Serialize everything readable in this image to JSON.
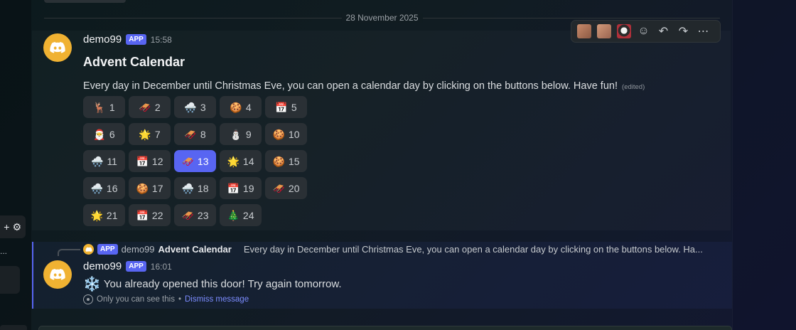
{
  "divider": {
    "date": "28 November 2025"
  },
  "message1": {
    "author": "demo99",
    "badge": "APP",
    "time": "15:58",
    "title": "Advent Calendar",
    "text": "Every day in December until Christmas Eve, you can open a calendar day by clicking on the buttons below. Have fun!",
    "edited": "(edited)",
    "buttons": [
      {
        "day": "1",
        "emoji": "🦌"
      },
      {
        "day": "2",
        "emoji": "🛷"
      },
      {
        "day": "3",
        "emoji": "🌨️"
      },
      {
        "day": "4",
        "emoji": "🍪"
      },
      {
        "day": "5",
        "emoji": "📅"
      },
      {
        "day": "6",
        "emoji": "🎅"
      },
      {
        "day": "7",
        "emoji": "🌟"
      },
      {
        "day": "8",
        "emoji": "🛷"
      },
      {
        "day": "9",
        "emoji": "⛄"
      },
      {
        "day": "10",
        "emoji": "🍪"
      },
      {
        "day": "11",
        "emoji": "🌨️"
      },
      {
        "day": "12",
        "emoji": "📅"
      },
      {
        "day": "13",
        "emoji": "🛷",
        "active": true
      },
      {
        "day": "14",
        "emoji": "🌟"
      },
      {
        "day": "15",
        "emoji": "🍪"
      },
      {
        "day": "16",
        "emoji": "🌨️"
      },
      {
        "day": "17",
        "emoji": "🍪"
      },
      {
        "day": "18",
        "emoji": "🌨️"
      },
      {
        "day": "19",
        "emoji": "📅"
      },
      {
        "day": "20",
        "emoji": "🛷"
      },
      {
        "day": "21",
        "emoji": "🌟"
      },
      {
        "day": "22",
        "emoji": "📅"
      },
      {
        "day": "23",
        "emoji": "🛷"
      },
      {
        "day": "24",
        "emoji": "🎄"
      }
    ]
  },
  "toolbar": {
    "items": [
      {
        "name": "reaction-1",
        "kind": "image"
      },
      {
        "name": "reaction-2",
        "kind": "image"
      },
      {
        "name": "reaction-3",
        "kind": "image"
      },
      {
        "name": "add-reaction-icon",
        "glyph": "☺"
      },
      {
        "name": "reply-icon",
        "glyph": "↶"
      },
      {
        "name": "forward-icon",
        "glyph": "↷"
      },
      {
        "name": "more-icon",
        "glyph": "⋯"
      }
    ]
  },
  "message2": {
    "reply_badge": "APP",
    "reply_author": "demo99",
    "reply_command": "Advent Calendar",
    "reply_preview": "Every day in December until Christmas Eve, you can open a calendar day by clicking on the buttons below. Ha...",
    "author": "demo99",
    "badge": "APP",
    "time": "16:01",
    "emoji": "❄️",
    "text": "You already opened this door! Try again tomorrow.",
    "ephemeral_note": "Only you can see this",
    "separator": "•",
    "dismiss": "Dismiss message"
  },
  "sidebar": {
    "truncated": "..."
  },
  "colors": {
    "accent": "#5865f2",
    "avatar": "#f0b232",
    "link": "#7c8cff"
  }
}
